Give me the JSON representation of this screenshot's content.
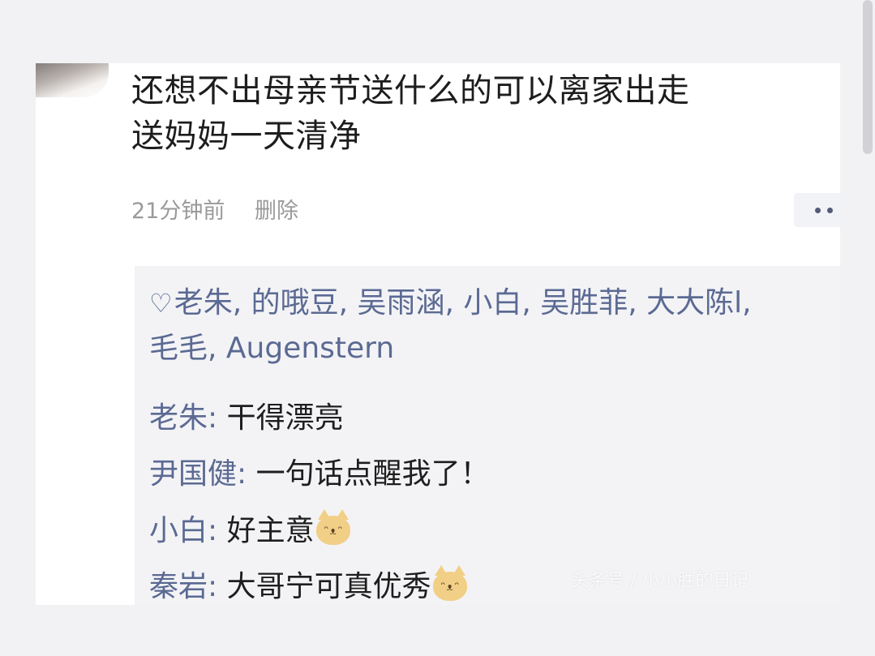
{
  "post": {
    "line1": "还想不出母亲节送什么的可以离家出走",
    "line2": "送妈妈一天清净",
    "time": "21分钟前",
    "delete_label": "删除"
  },
  "likes": {
    "icon": "heart-outline-icon",
    "line1": "老朱, 的哦豆, 吴雨涵, 小白, 吴胜菲, 大大陈l,",
    "line2": "毛毛, Augenstern"
  },
  "comments": [
    {
      "name": "老朱",
      "text": "干得漂亮",
      "emoji": ""
    },
    {
      "name": "尹国健",
      "text": "一句话点醒我了！",
      "emoji": ""
    },
    {
      "name": "小白",
      "text": "好主意",
      "emoji": "cat-emoji"
    },
    {
      "name": "秦岩",
      "text": "大哥宁可真优秀",
      "emoji": "cat-emoji"
    }
  ],
  "comment_separator": ": ",
  "watermark": "头条号 / 小小胜的日记",
  "colors": {
    "background": "#f2f2f4",
    "card": "#ffffff",
    "comment_bg": "#f3f3f6",
    "name_blue": "#5b6a93",
    "meta_gray": "#9a9a9a"
  }
}
